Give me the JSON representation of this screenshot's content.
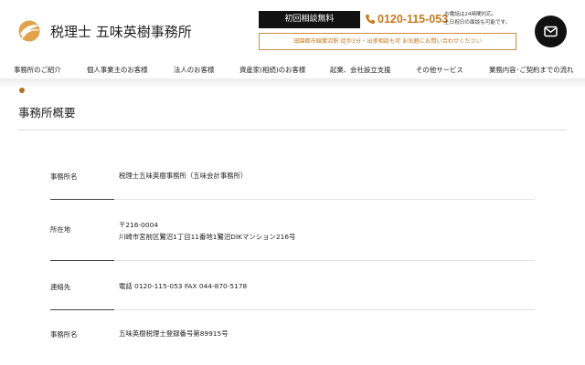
{
  "header": {
    "logo_text": "税理士 五味英樹事務所",
    "consult_label": "初回相談無料",
    "phone_number": "0120-115-053",
    "phone_note_1": "お電話は24時間対応。",
    "phone_note_2": "土日祝日の面談も可能です。",
    "access_note": "田園都市線鷺沼駅 徒歩3分・出張相談も可 お気軽にお問い合わせください"
  },
  "colors": {
    "accent": "#c77a1e",
    "dark": "#111111"
  },
  "icons": {
    "logo": "logo-leaf-icon",
    "phone": "phone-icon",
    "mail": "mail-icon"
  },
  "nav": {
    "items": [
      "事務所のご紹介",
      "個人事業主のお客様",
      "法人のお客様",
      "資産家(相続)のお客様",
      "起業、会社設立支援",
      "その他サービス",
      "業務内容･ご契約までの流れ"
    ]
  },
  "page": {
    "title": "事務所概要"
  },
  "info": {
    "rows": [
      {
        "label": "事務所名",
        "lines": [
          "税理士五味英樹事務所（五味会計事務所）"
        ]
      },
      {
        "label": "所在地",
        "lines": [
          "〒216-0004",
          "川崎市宮前区鷺沼1丁目11番地1鷺沼DIKマンション216号"
        ]
      },
      {
        "label": "連絡先",
        "lines": [
          "電話 0120-115-053 FAX 044-870-5178"
        ]
      },
      {
        "label": "事務所名",
        "lines": [
          "五味英樹税理士登録番号第89915号"
        ]
      }
    ]
  }
}
